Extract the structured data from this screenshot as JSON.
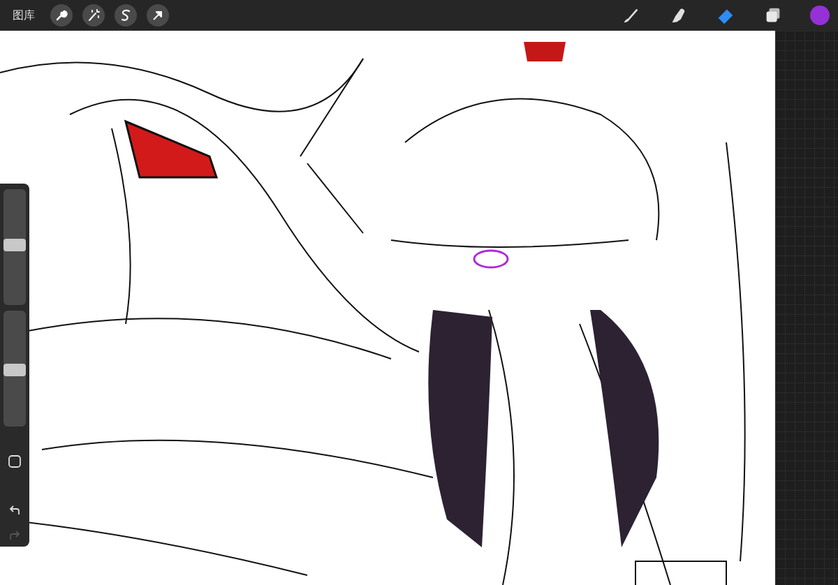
{
  "top_bar": {
    "gallery_label": "图库",
    "left_tools": [
      {
        "kind": "wrench"
      },
      {
        "kind": "wand"
      },
      {
        "kind": "selection"
      },
      {
        "kind": "transform"
      }
    ],
    "right_tools": [
      {
        "kind": "brush",
        "selected": false
      },
      {
        "kind": "smudge",
        "selected": false
      },
      {
        "kind": "eraser",
        "selected": true
      }
    ],
    "current_color": {
      "color": "#9531d6"
    }
  },
  "sidebar": {
    "sliders": [
      {
        "level": 0.52
      },
      {
        "level": 0.49
      }
    ],
    "undo": {
      "disabled": false
    },
    "redo": {
      "disabled": true
    }
  }
}
